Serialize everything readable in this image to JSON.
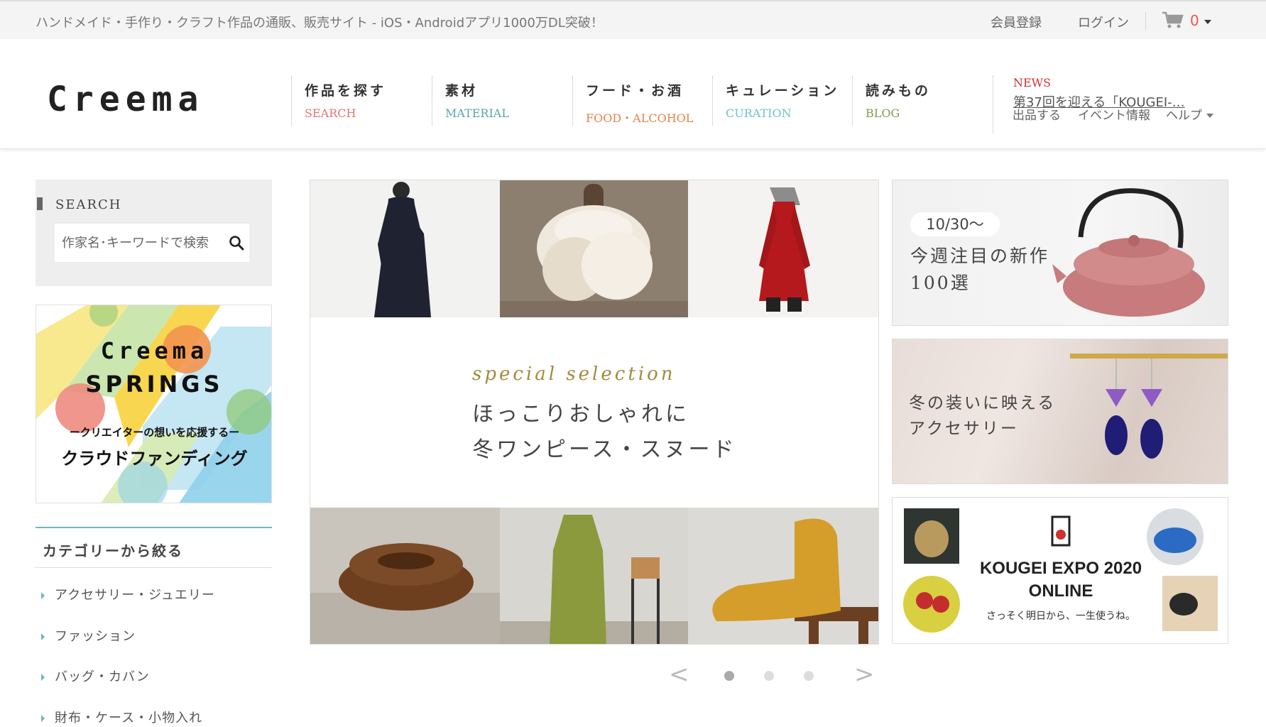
{
  "topbar": {
    "tagline": "ハンドメイド・手作り・クラフト作品の通販、販売サイト - iOS・Androidアプリ1000万DL突破！",
    "register": "会員登録",
    "login": "ログイン",
    "cart_count": "0"
  },
  "header": {
    "logo": "Creema",
    "nav": [
      {
        "jp": "作品を探す",
        "en": "SEARCH",
        "color": "#e57373"
      },
      {
        "jp": "素材",
        "en": "MATERIAL",
        "color": "#5aa6a6"
      },
      {
        "jp": "フード・お酒",
        "en": "FOOD・ALCOHOL",
        "color": "#e8834a"
      },
      {
        "jp": "キュレーション",
        "en": "CURATION",
        "color": "#6fc2c8"
      },
      {
        "jp": "読みもの",
        "en": "BLOG",
        "color": "#7aa048"
      }
    ],
    "news_label": "NEWS",
    "news_text": "第37回を迎える「KOUGEI-…",
    "sell": "出品する",
    "events": "イベント情報",
    "help": "ヘルプ"
  },
  "sidebar": {
    "search_title": "SEARCH",
    "search_placeholder": "作家名･キーワードで検索",
    "springs": {
      "line1": "Creema",
      "line2": "SPRINGS",
      "line3": "ークリエイターの想いを応援するー",
      "line4": "クラウドファンディング"
    },
    "category_title": "カテゴリーから絞る",
    "categories": [
      "アクセサリー・ジュエリー",
      "ファッション",
      "バッグ・カバン",
      "財布・ケース・小物入れ"
    ]
  },
  "feature": {
    "special": "special selection",
    "headline_1": "ほっこりおしゃれに",
    "headline_2": "冬ワンピース・スヌード"
  },
  "banners": {
    "b1_date": "10/30〜",
    "b1_line1": "今週注目の新作",
    "b1_line2": "100選",
    "b2_line1": "冬の装いに映える",
    "b2_line2": "アクセサリー",
    "b3_line1": "KOUGEI EXPO 2020",
    "b3_line2": "ONLINE",
    "b3_line3": "さっそく明日から、一生使うね。"
  },
  "carousel": {
    "prev": "<",
    "next": ">",
    "dots": 3,
    "active_dot": 1
  },
  "colors": {
    "accent_teal": "#6bb8c1",
    "news_red": "#d0312d",
    "cart_red": "#e8594a",
    "special_gold": "#a38a3b"
  }
}
